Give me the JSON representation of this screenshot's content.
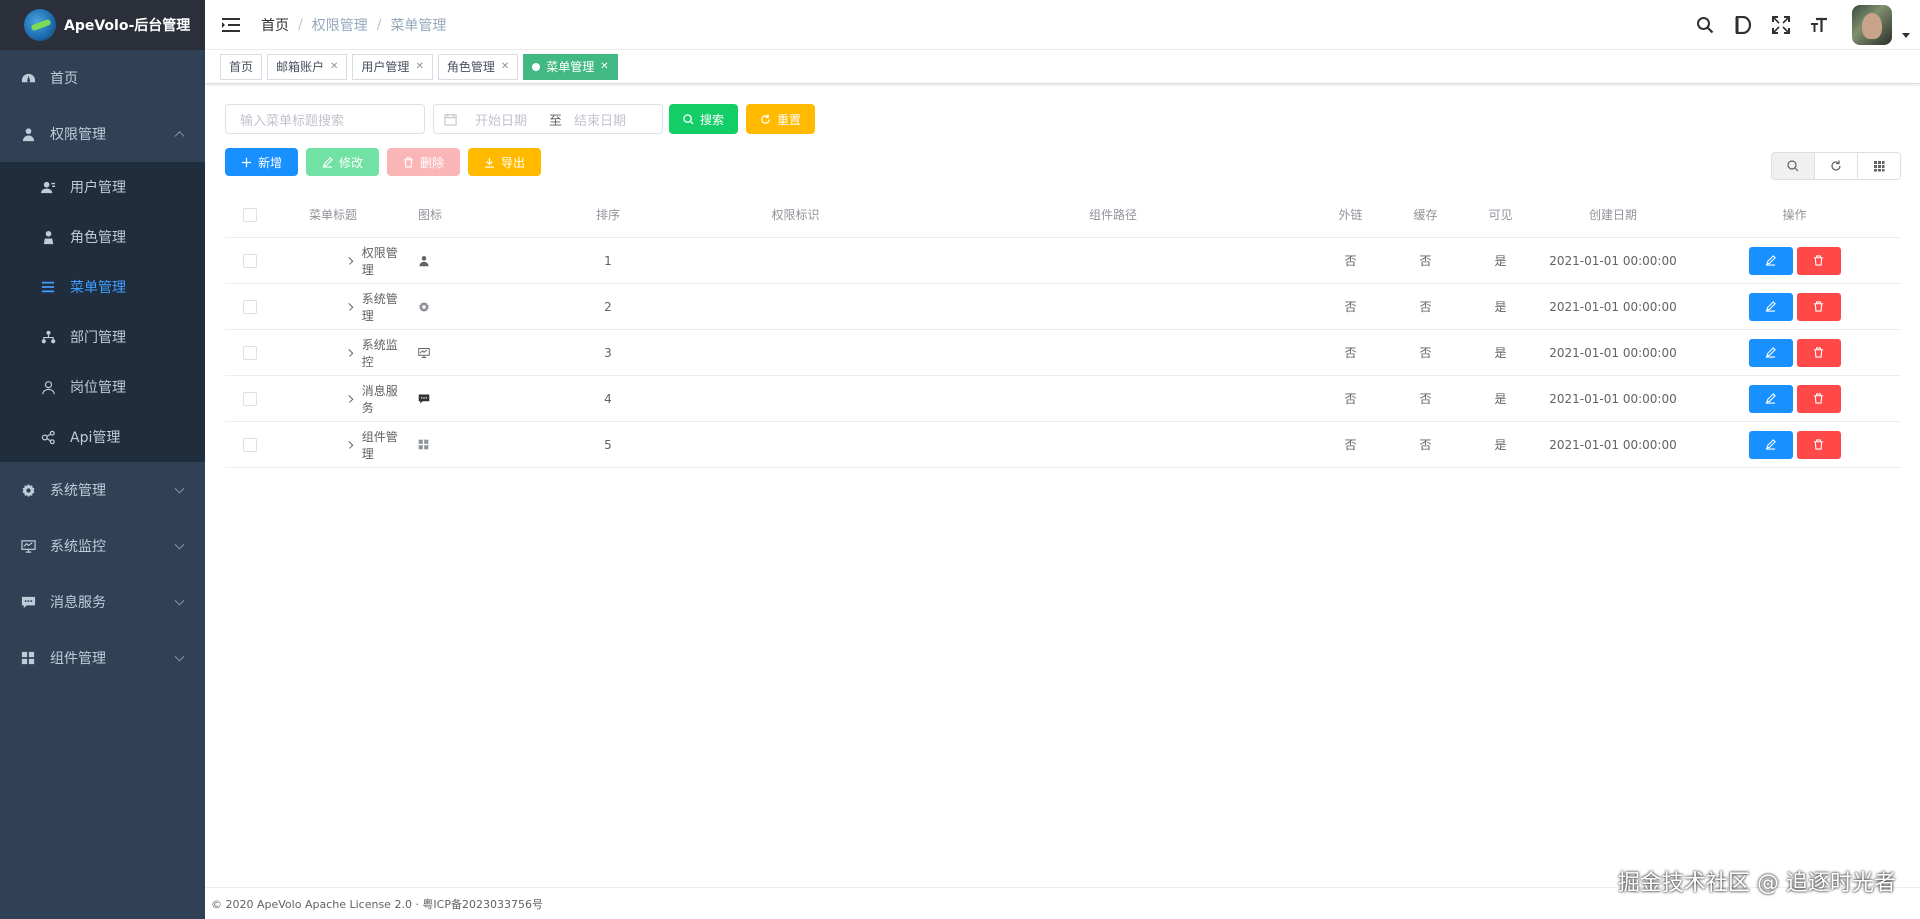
{
  "app": {
    "title": "ApeVolo-后台管理"
  },
  "sidebar": {
    "items": [
      {
        "label": "首页",
        "icon": "dashboard-icon"
      },
      {
        "label": "权限管理",
        "icon": "permission-icon",
        "open": true,
        "children": [
          {
            "label": "用户管理",
            "icon": "user-icon"
          },
          {
            "label": "角色管理",
            "icon": "role-icon"
          },
          {
            "label": "菜单管理",
            "icon": "menu-icon",
            "active": true
          },
          {
            "label": "部门管理",
            "icon": "dept-icon"
          },
          {
            "label": "岗位管理",
            "icon": "post-icon"
          },
          {
            "label": "Api管理",
            "icon": "api-icon"
          }
        ]
      },
      {
        "label": "系统管理",
        "icon": "gear-icon"
      },
      {
        "label": "系统监控",
        "icon": "monitor-icon"
      },
      {
        "label": "消息服务",
        "icon": "message-icon"
      },
      {
        "label": "组件管理",
        "icon": "grid-icon"
      }
    ]
  },
  "breadcrumb": [
    "首页",
    "权限管理",
    "菜单管理"
  ],
  "tags": [
    {
      "label": "首页"
    },
    {
      "label": "邮箱账户"
    },
    {
      "label": "用户管理"
    },
    {
      "label": "角色管理"
    },
    {
      "label": "菜单管理",
      "active": true
    }
  ],
  "filters": {
    "search_placeholder": "输入菜单标题搜索",
    "start_placeholder": "开始日期",
    "range_sep": "至",
    "end_placeholder": "结束日期",
    "search_label": "搜索",
    "reset_label": "重置"
  },
  "toolbar": {
    "add": "新增",
    "edit": "修改",
    "delete": "删除",
    "export": "导出"
  },
  "table": {
    "headers": {
      "title": "菜单标题",
      "icon": "图标",
      "sort": "排序",
      "perm": "权限标识",
      "path": "组件路径",
      "ext": "外链",
      "cache": "缓存",
      "visible": "可见",
      "date": "创建日期",
      "ops": "操作"
    },
    "rows": [
      {
        "title": "权限管理",
        "icon": "permission-icon",
        "sort": "1",
        "ext": "否",
        "cache": "否",
        "visible": "是",
        "date": "2021-01-01 00:00:00"
      },
      {
        "title": "系统管理",
        "icon": "gear-icon",
        "sort": "2",
        "ext": "否",
        "cache": "否",
        "visible": "是",
        "date": "2021-01-01 00:00:00"
      },
      {
        "title": "系统监控",
        "icon": "monitor-icon",
        "sort": "3",
        "ext": "否",
        "cache": "否",
        "visible": "是",
        "date": "2021-01-01 00:00:00"
      },
      {
        "title": "消息服务",
        "icon": "message-icon",
        "sort": "4",
        "ext": "否",
        "cache": "否",
        "visible": "是",
        "date": "2021-01-01 00:00:00"
      },
      {
        "title": "组件管理",
        "icon": "grid-icon",
        "sort": "5",
        "ext": "否",
        "cache": "否",
        "visible": "是",
        "date": "2021-01-01 00:00:00"
      }
    ]
  },
  "footer": {
    "text": "© 2020 ApeVolo Apache License 2.0 · 粤ICP备2023033756号"
  },
  "watermark": "掘金技术社区 @ 追逐时光者",
  "colors": {
    "sidebar": "#304156",
    "submenu": "#1f2d3d",
    "active": "#409eff",
    "tag_active": "#42b983"
  }
}
